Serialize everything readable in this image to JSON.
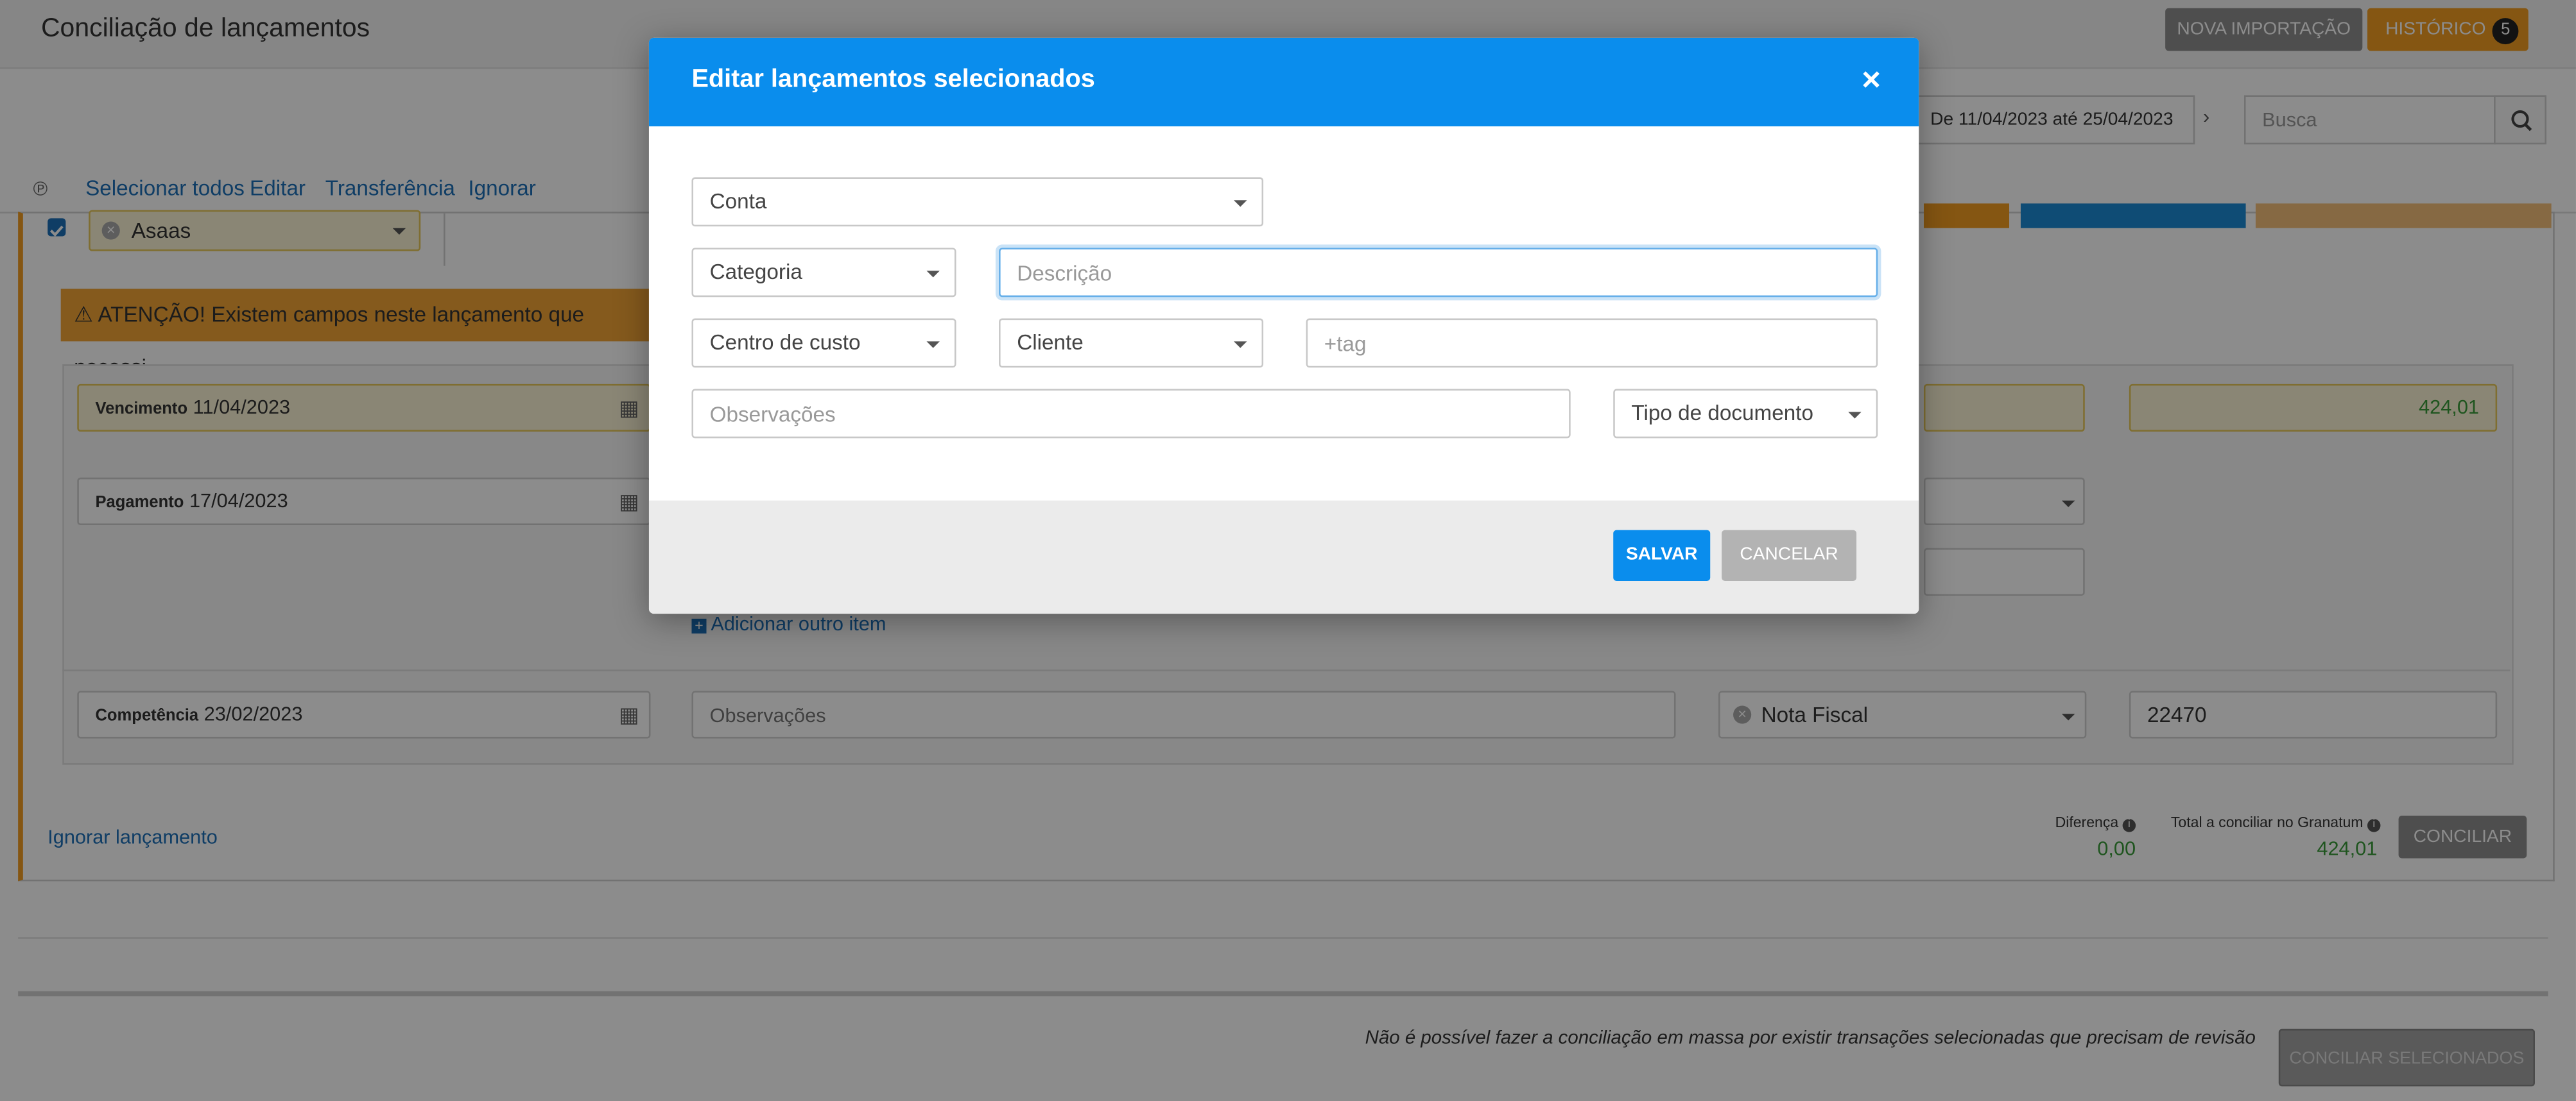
{
  "page": {
    "title": "Conciliação de lançamentos",
    "nova_importacao": "NOVA IMPORTAÇÃO",
    "historico": "HISTÓRICO",
    "historico_count": "5",
    "date_range": "De 11/04/2023 até 25/04/2023",
    "search_placeholder": "Busca"
  },
  "toolbar": {
    "selecionar_todos": "Selecionar todos",
    "editar": "Editar",
    "transferencia": "Transferência",
    "ignorar": "Ignorar"
  },
  "entry": {
    "account": "Asaas",
    "warning": "ATENÇÃO! Existem campos neste lançamento que necessi",
    "vencimento_label": "Vencimento",
    "vencimento": "11/04/2023",
    "pagamento_label": "Pagamento",
    "pagamento": "17/04/2023",
    "competencia_label": "Competência",
    "competencia": "23/02/2023",
    "valor": "424,01",
    "add_item": "Adicionar outro item",
    "observacoes_placeholder": "Observações",
    "tipo_documento": "Nota Fiscal",
    "numero_documento": "22470",
    "ignorar_lancamento": "Ignorar lançamento",
    "diferenca_label": "Diferença",
    "diferenca": "0,00",
    "total_label": "Total a conciliar no Granatum",
    "total": "424,01",
    "conciliar": "CONCILIAR"
  },
  "footer": {
    "message": "Não é possível fazer a conciliação em massa por existir transações selecionadas que precisam de revisão",
    "conciliar_selecionados": "CONCILIAR SELECIONADOS"
  },
  "modal": {
    "title": "Editar lançamentos selecionados",
    "conta": "Conta",
    "categoria": "Categoria",
    "descricao_placeholder": "Descrição",
    "centro_de_custo": "Centro de custo",
    "cliente": "Cliente",
    "tag_placeholder": "+tag",
    "observacoes_placeholder": "Observações",
    "tipo_documento": "Tipo de documento",
    "salvar": "SALVAR",
    "cancelar": "CANCELAR"
  },
  "colors": {
    "primary_blue": "#0a8ded",
    "orange": "#f29d21",
    "green": "#3a9b3a"
  }
}
